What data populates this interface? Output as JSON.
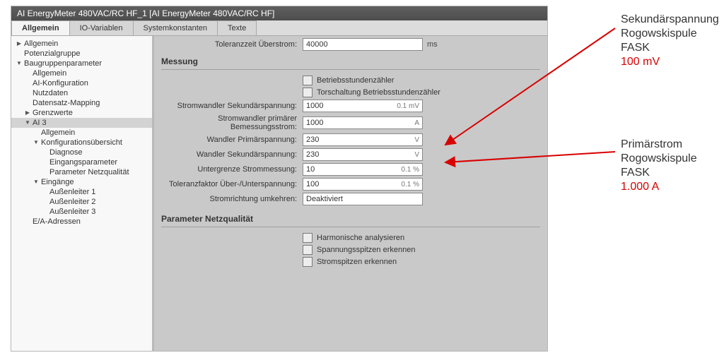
{
  "title": "AI EnergyMeter 480VAC/RC HF_1 [AI EnergyMeter 480VAC/RC HF]",
  "tabs": [
    "Allgemein",
    "IO-Variablen",
    "Systemkonstanten",
    "Texte"
  ],
  "activeTab": 0,
  "tree": [
    {
      "caret": "▶",
      "label": "Allgemein",
      "indent": 0
    },
    {
      "caret": "",
      "label": "Potenzialgruppe",
      "indent": 0
    },
    {
      "caret": "▼",
      "label": "Baugruppenparameter",
      "indent": 0
    },
    {
      "caret": "",
      "label": "Allgemein",
      "indent": 1
    },
    {
      "caret": "",
      "label": "AI-Konfiguration",
      "indent": 1
    },
    {
      "caret": "",
      "label": "Nutzdaten",
      "indent": 1
    },
    {
      "caret": "",
      "label": "Datensatz-Mapping",
      "indent": 1
    },
    {
      "caret": "▶",
      "label": "Grenzwerte",
      "indent": 1
    },
    {
      "caret": "▼",
      "label": "AI 3",
      "indent": 1,
      "selected": true
    },
    {
      "caret": "",
      "label": "Allgemein",
      "indent": 2
    },
    {
      "caret": "▼",
      "label": "Konfigurationsübersicht",
      "indent": 2
    },
    {
      "caret": "",
      "label": "Diagnose",
      "indent": 3
    },
    {
      "caret": "",
      "label": "Eingangsparameter",
      "indent": 3
    },
    {
      "caret": "",
      "label": "Parameter Netzqualität",
      "indent": 3
    },
    {
      "caret": "▼",
      "label": "Eingänge",
      "indent": 2
    },
    {
      "caret": "",
      "label": "Außenleiter 1",
      "indent": 3
    },
    {
      "caret": "",
      "label": "Außenleiter 2",
      "indent": 3
    },
    {
      "caret": "",
      "label": "Außenleiter 3",
      "indent": 3
    },
    {
      "caret": "",
      "label": "E/A-Adressen",
      "indent": 1
    }
  ],
  "toprow": {
    "label": "Toleranzzeit Überstrom:",
    "value": "40000",
    "unit": "ms"
  },
  "group1": {
    "title": "Messung",
    "checks": [
      {
        "label": "Betriebsstundenzähler"
      },
      {
        "label": "Torschaltung Betriebsstundenzähler"
      }
    ],
    "rows": [
      {
        "label": "Stromwandler Sekundärspannung:",
        "value": "1000",
        "unitIn": "0.1 mV"
      },
      {
        "label": "Stromwandler primärer Bemessungsstrom:",
        "value": "1000",
        "unitIn": "A"
      },
      {
        "label": "Wandler Primärspannung:",
        "value": "230",
        "unitIn": "V"
      },
      {
        "label": "Wandler Sekundärspannung:",
        "value": "230",
        "unitIn": "V"
      },
      {
        "label": "Untergrenze Strommessung:",
        "value": "10",
        "unitIn": "0.1 %"
      },
      {
        "label": "Toleranzfaktor Über-/Unterspannung:",
        "value": "100",
        "unitIn": "0.1 %"
      },
      {
        "label": "Stromrichtung umkehren:",
        "value": "Deaktiviert",
        "unitIn": ""
      }
    ]
  },
  "group2": {
    "title": "Parameter Netzqualität",
    "checks": [
      {
        "label": "Harmonische analysieren"
      },
      {
        "label": "Spannungsspitzen erkennen"
      },
      {
        "label": "Stromspitzen erkennen"
      }
    ]
  },
  "annot1": {
    "l1": "Sekundärspannung",
    "l2": "Rogowskispule FASK",
    "l3": "100 mV"
  },
  "annot2": {
    "l1": "Primärstrom",
    "l2": "Rogowskispule FASK",
    "l3": "1.000 A"
  }
}
